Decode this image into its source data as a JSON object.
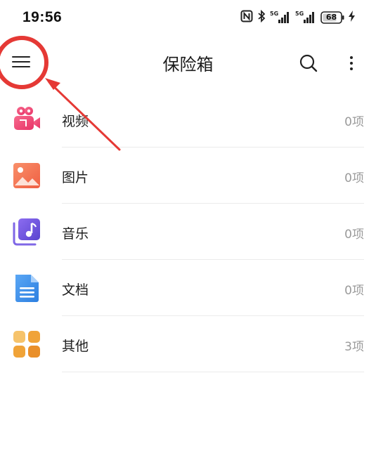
{
  "status_bar": {
    "time": "19:56",
    "battery": "68",
    "signal_label_1": "5G",
    "signal_label_2": "5G",
    "icons": [
      "nfc-icon",
      "bluetooth-icon",
      "signal-5g-icon",
      "signal-5g-icon",
      "battery-icon",
      "charging-icon"
    ]
  },
  "app_bar": {
    "title": "保险箱",
    "icons": [
      "menu-icon",
      "search-icon",
      "more-icon"
    ]
  },
  "colors": {
    "video": "#ee4a77",
    "image": "#f26a4a",
    "music": "#6b55d6",
    "document": "#3a8be6",
    "other": "#f0a338",
    "annotation": "#e53935"
  },
  "categories": [
    {
      "label": "视频",
      "count": "0项",
      "icon": "video-camera-icon"
    },
    {
      "label": "图片",
      "count": "0项",
      "icon": "image-icon"
    },
    {
      "label": "音乐",
      "count": "0项",
      "icon": "music-icon"
    },
    {
      "label": "文档",
      "count": "0项",
      "icon": "document-icon"
    },
    {
      "label": "其他",
      "count": "3项",
      "icon": "grid-icon"
    }
  ]
}
